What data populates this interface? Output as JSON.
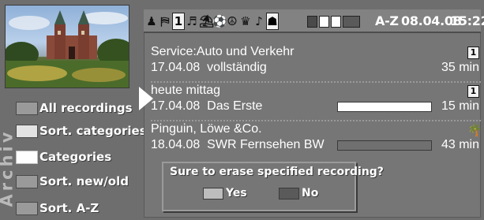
{
  "left_panel": {
    "section_vertical_label": "Archiv",
    "menu": [
      {
        "label": "All recordings",
        "swatch": "#9a9a9a"
      },
      {
        "label": "Sort. categories",
        "swatch": "#e3e3e3"
      },
      {
        "label": "Categories",
        "swatch": "#ffffff"
      },
      {
        "label": "Sort. new/old",
        "swatch": "#9a9a9a"
      },
      {
        "label": "Sort. A-Z",
        "swatch": "#9a9a9a"
      }
    ]
  },
  "header": {
    "category_icons": [
      "♟",
      "⛿",
      "1",
      "♬",
      "⛱",
      "⚽",
      "☮",
      "♛",
      "♪",
      "☗"
    ],
    "sort_mode": "A-Z",
    "date": "08.04.08",
    "time": "15:22"
  },
  "recordings": [
    {
      "title": "Service:Auto und Verkehr",
      "date": "17.04.08",
      "info": "vollständig",
      "duration": "35 min",
      "icon": "calendar-1-icon",
      "progress": null
    },
    {
      "title": "heute mittag",
      "date": "17.04.08",
      "info": "Das Erste",
      "duration": "15 min",
      "icon": "calendar-1-icon",
      "progress": 1.0
    },
    {
      "title": "Pinguin, Löwe &Co.",
      "date": "18.04.08",
      "info": "SWR Fernsehen BW",
      "duration": "43 min",
      "icon": "palm-tree-icon",
      "progress": 0.0
    }
  ],
  "dialog": {
    "question": "Sure to erase specified recording?",
    "yes_label": "Yes",
    "no_label": "No",
    "yes_color": "#bdbdbd",
    "no_color": "#5a5a5a"
  },
  "colors": {
    "background": "#6e6e6e",
    "text": "#ffffff"
  }
}
